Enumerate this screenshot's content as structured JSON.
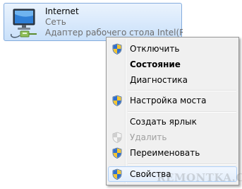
{
  "connection": {
    "name": "Internet",
    "status": "Сеть",
    "device": "Адаптер рабочего стола Intel(R) ...",
    "icon": "network-adapter-icon"
  },
  "context_menu": {
    "items": [
      {
        "label": "Отключить",
        "icon": "uac-shield-icon",
        "bold": false,
        "enabled": true
      },
      {
        "label": "Состояние",
        "icon": null,
        "bold": true,
        "enabled": true
      },
      {
        "label": "Диагностика",
        "icon": null,
        "bold": false,
        "enabled": true
      },
      {
        "label": "Настройка моста",
        "icon": "uac-shield-icon",
        "bold": false,
        "enabled": true
      },
      {
        "label": "Создать ярлык",
        "icon": null,
        "bold": false,
        "enabled": true
      },
      {
        "label": "Удалить",
        "icon": "uac-shield-disabled-icon",
        "bold": false,
        "enabled": false
      },
      {
        "label": "Переименовать",
        "icon": "uac-shield-icon",
        "bold": false,
        "enabled": true
      },
      {
        "label": "Свойства",
        "icon": "uac-shield-icon",
        "bold": false,
        "enabled": true,
        "hovered": true
      }
    ]
  },
  "watermark": {
    "text": "REMONTKA.COM"
  },
  "colors": {
    "tile_border": "#84acdd",
    "tile_background": "#c9e0fa",
    "menu_background": "#f0f0f0",
    "menu_hover_border": "#aecff7",
    "disabled_text": "#a0a0a0",
    "status_text": "#6d6d6d"
  }
}
